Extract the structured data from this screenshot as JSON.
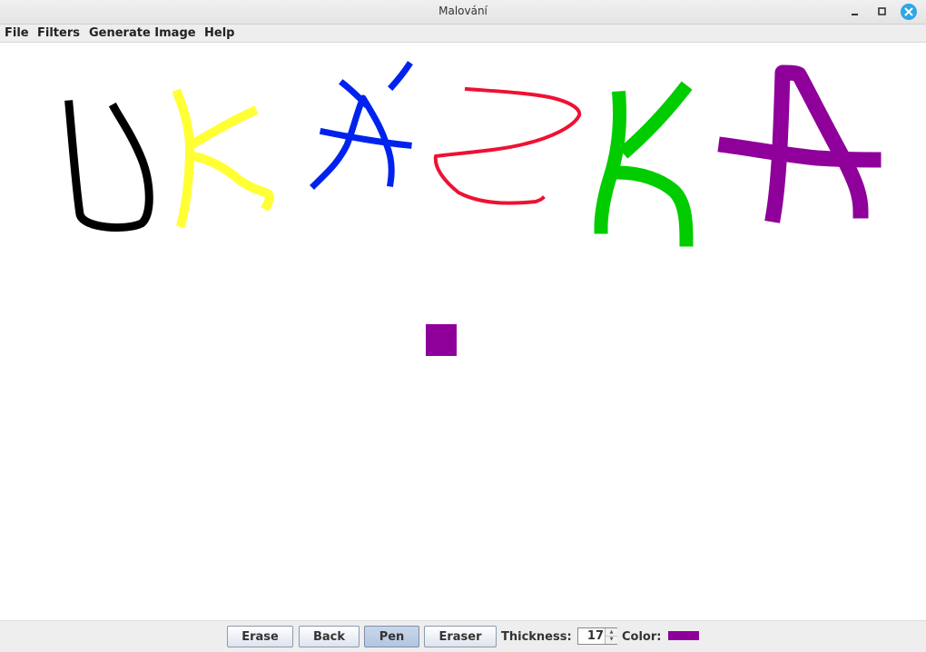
{
  "window": {
    "title": "Malování"
  },
  "menu": {
    "items": [
      {
        "label": "File"
      },
      {
        "label": "Filters"
      },
      {
        "label": "Generate Image"
      },
      {
        "label": "Help"
      }
    ]
  },
  "canvas": {
    "strokes": [
      {
        "letter": "U",
        "color": "#000000"
      },
      {
        "letter": "K",
        "color": "#ffff33"
      },
      {
        "letter": "Á",
        "color": "#0022ee"
      },
      {
        "letter": "Ž",
        "color": "#ee1133"
      },
      {
        "letter": "K",
        "color": "#00cc00"
      },
      {
        "letter": "A",
        "color": "#8e0099"
      }
    ],
    "square_color": "#8e0099"
  },
  "toolbar": {
    "erase_label": "Erase",
    "back_label": "Back",
    "pen_label": "Pen",
    "eraser_label": "Eraser",
    "active_tool": "Pen",
    "thickness_label": "Thickness:",
    "thickness_value": "17",
    "color_label": "Color:",
    "current_color": "#8e0099"
  },
  "icons": {
    "minimize": "minimize-icon",
    "maximize": "maximize-icon",
    "close": "close-icon",
    "spinner_up": "spinner-up-icon",
    "spinner_down": "spinner-down-icon"
  }
}
